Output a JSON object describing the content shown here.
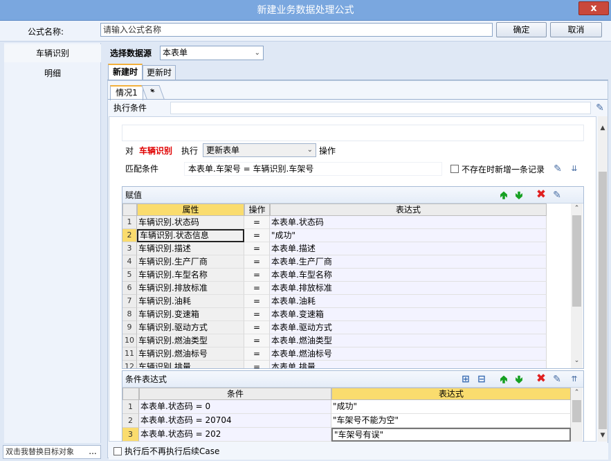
{
  "window": {
    "title": "新建业务数据处理公式",
    "close_glyph": "x"
  },
  "formula": {
    "name_label": "公式名称:",
    "name_placeholder": "请输入公式名称",
    "ok_label": "确定",
    "cancel_label": "取消"
  },
  "sidebar": {
    "items": [
      {
        "label": "车辆识别"
      },
      {
        "label": "明细"
      }
    ],
    "bottom_text": "双击我替换目标对象",
    "more_glyph": "..."
  },
  "datasource": {
    "label": "选择数据源",
    "value": "本表单"
  },
  "tabs": [
    {
      "label": "新建时"
    },
    {
      "label": "更新时"
    }
  ],
  "cases": {
    "tab_label": "情况1",
    "add_label": "*"
  },
  "exec_condition": {
    "label": "执行条件",
    "value": ""
  },
  "context": {
    "prefix": "对",
    "target": "车辆识别",
    "exec_label": "执行",
    "action": "更新表单",
    "op_label": "操作"
  },
  "match": {
    "label": "匹配条件",
    "value": "本表单.车架号 = 车辆识别.车架号",
    "new_record_label": "不存在时新增一条记录"
  },
  "assign": {
    "title": "赋值",
    "columns": [
      "属性",
      "操作",
      "表达式"
    ],
    "rows": [
      {
        "n": "1",
        "prop": "车辆识别.状态码",
        "op": "=",
        "expr": "本表单.状态码"
      },
      {
        "n": "2",
        "prop": "车辆识别.状态信息",
        "op": "=",
        "expr": "\"成功\""
      },
      {
        "n": "3",
        "prop": "车辆识别.描述",
        "op": "=",
        "expr": "本表单.描述"
      },
      {
        "n": "4",
        "prop": "车辆识别.生产厂商",
        "op": "=",
        "expr": "本表单.生产厂商"
      },
      {
        "n": "5",
        "prop": "车辆识别.车型名称",
        "op": "=",
        "expr": "本表单.车型名称"
      },
      {
        "n": "6",
        "prop": "车辆识别.排放标准",
        "op": "=",
        "expr": "本表单.排放标准"
      },
      {
        "n": "7",
        "prop": "车辆识别.油耗",
        "op": "=",
        "expr": "本表单.油耗"
      },
      {
        "n": "8",
        "prop": "车辆识别.变速箱",
        "op": "=",
        "expr": "本表单.变速箱"
      },
      {
        "n": "9",
        "prop": "车辆识别.驱动方式",
        "op": "=",
        "expr": "本表单.驱动方式"
      },
      {
        "n": "10",
        "prop": "车辆识别.燃油类型",
        "op": "=",
        "expr": "本表单.燃油类型"
      },
      {
        "n": "11",
        "prop": "车辆识别.燃油标号",
        "op": "=",
        "expr": "本表单.燃油标号"
      },
      {
        "n": "12",
        "prop": "车辆识别.排量",
        "op": "=",
        "expr": "本表单.排量"
      }
    ]
  },
  "cond_expr": {
    "title": "条件表达式",
    "columns": [
      "条件",
      "表达式"
    ],
    "rows": [
      {
        "n": "1",
        "cond": "本表单.状态码 = 0",
        "expr": "\"成功\""
      },
      {
        "n": "2",
        "cond": "本表单.状态码 = 20704",
        "expr": "\"车架号不能为空\""
      },
      {
        "n": "3",
        "cond": "本表单.状态码 = 202",
        "expr": "\"车架号有误\""
      }
    ]
  },
  "footer": {
    "label": "执行后不再执行后续Case"
  },
  "icons": {
    "up": "arrow-up-icon",
    "down": "arrow-down-icon",
    "delete": "delete-icon",
    "edit": "edit-icon",
    "add": "add-row-icon"
  },
  "colors": {
    "accent": "#f3b03b",
    "title_bar": "#7aa7df",
    "target_text": "#e00000",
    "header_active": "#fadc6e"
  }
}
